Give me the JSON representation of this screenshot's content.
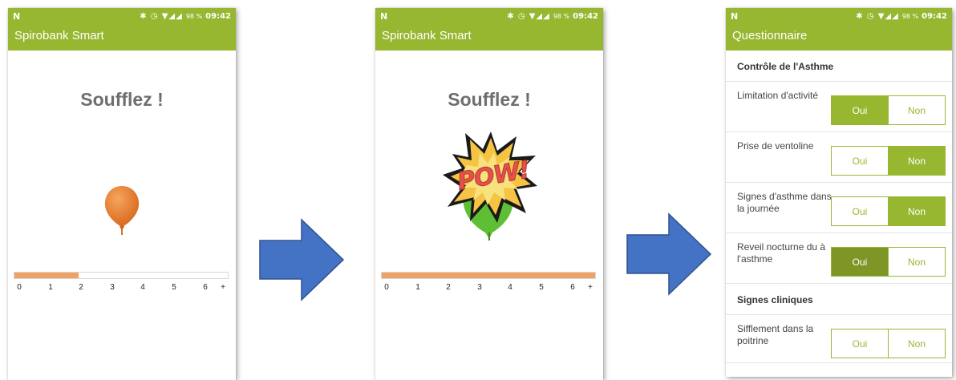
{
  "status_bar": {
    "notification_icon": "N",
    "icons": "✱ ◷ ▼◢◢",
    "battery": "98 %",
    "time": "09:42"
  },
  "screen1": {
    "app_title": "Spirobank Smart",
    "instruction": "Soufflez !",
    "balloon_icon": "balloon-icon",
    "balloon_color": "#e9823a",
    "progress": 0.3,
    "progress_color": "#f0a266",
    "ticks": [
      "0",
      "1",
      "2",
      "3",
      "4",
      "5",
      "6",
      "+"
    ]
  },
  "screen2": {
    "app_title": "Spirobank Smart",
    "instruction": "Soufflez !",
    "burst_text": "POW!",
    "progress": 1.0,
    "progress_color": "#f0a266",
    "ticks": [
      "0",
      "1",
      "2",
      "3",
      "4",
      "5",
      "6",
      "+"
    ]
  },
  "arrows": {
    "color": "#4472c4",
    "icon": "right-arrow-icon"
  },
  "screen3": {
    "app_title": "Questionnaire",
    "accent_color": "#97b731",
    "section1_title": "Contrôle de l'Asthme",
    "questions": [
      {
        "label": "Limitation d'activité",
        "yes": "Oui",
        "no": "Non",
        "selected": "yes"
      },
      {
        "label": "Prise de ventoline",
        "yes": "Oui",
        "no": "Non",
        "selected": "no"
      },
      {
        "label": "Signes d'asthme dans la journée",
        "yes": "Oui",
        "no": "Non",
        "selected": "no"
      },
      {
        "label": "Reveil nocturne du à l'asthme",
        "yes": "Oui",
        "no": "Non",
        "selected": "yes"
      }
    ],
    "section2_title": "Signes cliniques",
    "clinical": [
      {
        "label": "Sifflement dans la poitrine",
        "yes": "Oui",
        "no": "Non",
        "selected": "none"
      }
    ]
  }
}
